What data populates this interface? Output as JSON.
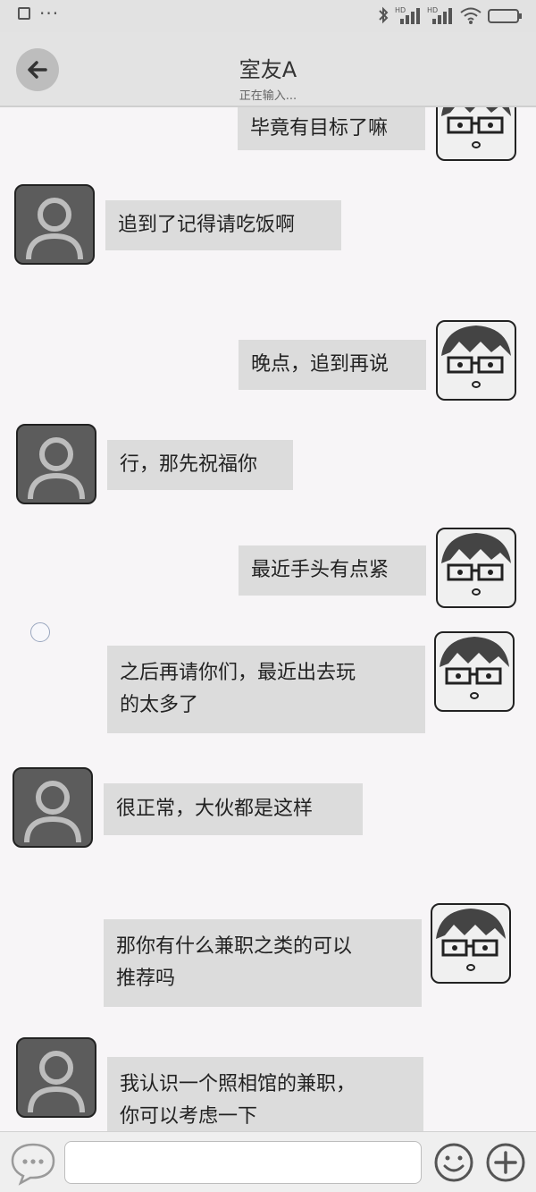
{
  "status_bar": {
    "icons": [
      "square-icon",
      "more-dots-icon",
      "bluetooth-icon",
      "signal-hd-icon",
      "signal-hd-icon",
      "wifi-icon",
      "battery-icon"
    ]
  },
  "header": {
    "title": "室友A",
    "subtitle": "正在输入..."
  },
  "messages": [
    {
      "side": "me",
      "text": "毕竟有目标了嘛"
    },
    {
      "side": "friend",
      "text": "追到了记得请吃饭啊"
    },
    {
      "side": "me",
      "text": "晚点，追到再说"
    },
    {
      "side": "friend",
      "text": "行，那先祝福你"
    },
    {
      "side": "me",
      "text": "最近手头有点紧"
    },
    {
      "side": "me",
      "text": "之后再请你们，最近出去玩\n的太多了"
    },
    {
      "side": "friend",
      "text": "很正常，大伙都是这样"
    },
    {
      "side": "me",
      "text": "那你有什么兼职之类的可以\n推荐吗"
    },
    {
      "side": "friend",
      "text": "我认识一个照相馆的兼职，\n你可以考虑一下"
    }
  ],
  "input_bar": {
    "placeholder": "",
    "icons": [
      "voice-bubble-icon",
      "emoji-icon",
      "plus-icon"
    ]
  }
}
